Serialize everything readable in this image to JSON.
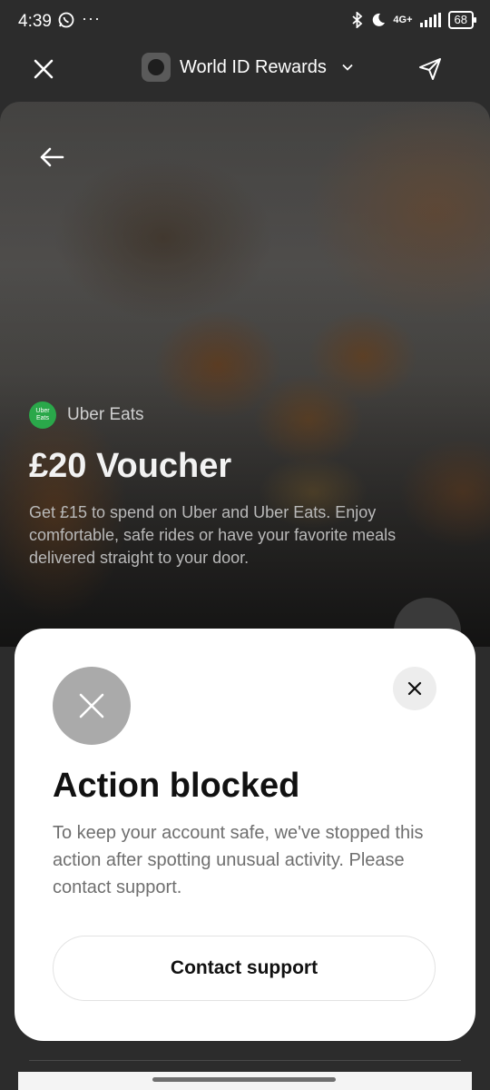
{
  "status_bar": {
    "time": "4:39",
    "left_icons": [
      "whatsapp-icon",
      "more-dots-icon"
    ],
    "network": "4G+",
    "battery": "68"
  },
  "header": {
    "title": "World ID Rewards"
  },
  "voucher": {
    "brand_logo_text_line1": "Uber",
    "brand_logo_text_line2": "Eats",
    "brand_name": "Uber Eats",
    "title": "£20 Voucher",
    "description": "Get £15 to spend on Uber and Uber Eats. Enjoy comfortable, safe rides or have your favorite meals delivered straight to your door."
  },
  "modal": {
    "title": "Action blocked",
    "message": "To keep your account safe, we've stopped this action after spotting unusual activity. Please contact support.",
    "button_label": "Contact support"
  },
  "colors": {
    "brand_green": "#2aa84a",
    "sheet_bg": "#ffffff",
    "blocked_icon_bg": "#aaaaaa"
  }
}
